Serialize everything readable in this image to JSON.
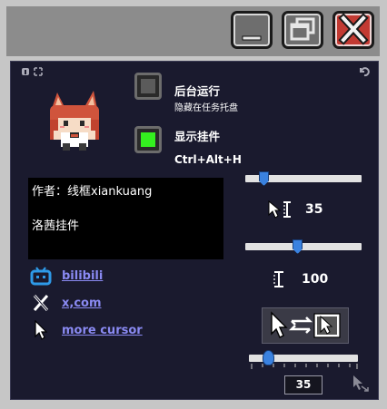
{
  "window_controls": {
    "minimize": "minimize-icon",
    "maximize": "restore-icon",
    "close": "close-icon"
  },
  "options": {
    "background_run": {
      "label": "后台运行",
      "sublabel": "隐藏在任务托盘",
      "enabled": false
    },
    "show_pendant": {
      "label": "显示挂件",
      "shortcut": "Ctrl+Alt+H",
      "enabled": true
    }
  },
  "info": {
    "author_line": "作者：线框xiankuang",
    "pendant_name": "洛茜挂件"
  },
  "links": [
    {
      "icon": "bilibili-icon",
      "label": "bilibili"
    },
    {
      "icon": "x-icon",
      "label": "x,com"
    },
    {
      "icon": "cursor-icon",
      "label": "more cursor"
    }
  ],
  "sliders": {
    "cursor_size": {
      "value": "35",
      "fraction": 0.16
    },
    "text_cursor_size": {
      "value": "100",
      "fraction": 0.45
    },
    "pendant_size": {
      "value": "35",
      "fraction": 0.18
    }
  },
  "colors": {
    "accent": "#3a82e0",
    "panel": "#1a1a2e",
    "link": "#8a8af2",
    "toggle_on": "#34f01f",
    "close": "#c23a32"
  }
}
